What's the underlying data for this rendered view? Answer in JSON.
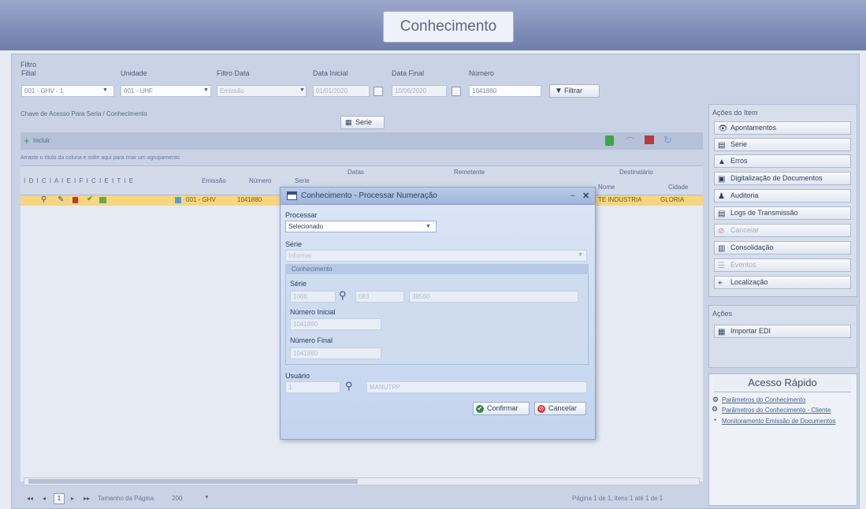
{
  "header": {
    "title": "Conhecimento"
  },
  "filters": {
    "legend": "Filtro",
    "filial": {
      "label": "Filial",
      "value": "001 - GHV - 1"
    },
    "unidade": {
      "label": "Unidade",
      "value": "001 - UHF"
    },
    "filtro_data": {
      "label": "Filtro Data",
      "value": "Emissão"
    },
    "data_inicial": {
      "label": "Data Inicial",
      "value": "01/01/2020"
    },
    "data_final": {
      "label": "Data Final",
      "value": "10/06/2020"
    },
    "numero": {
      "label": "Número",
      "value": "1041880"
    },
    "filter_button": "Filtrar"
  },
  "grid": {
    "info": "Chave de Acesso Para Seria / Conhecimento",
    "serie_button": "Serie",
    "add_button": "Incluir",
    "drag_hint": "Arraste o título da coluna e solte aqui para criar um agrupamento",
    "headers": {
      "letters": "I  D  I  C  I  A  I  E  I  F  I  C  I  E  I  T  I  E",
      "emissao": "Emissão",
      "numero": "Número",
      "serie": "Serie",
      "datas": "Datas",
      "remetente": "Remetente",
      "destinatario": "Destinatário",
      "nome": "Nome",
      "cidade": "Cidade"
    },
    "row": {
      "unidade": "001 - GHV",
      "numero": "1041880",
      "nome": "TE INDUSTRIA",
      "cidade": "GLORIA"
    },
    "pager": {
      "current_page": "1",
      "page_size_label": "Tamanho da Página",
      "page_size": "200",
      "status": "Página 1 de 1, itens 1 até 1 de 1"
    }
  },
  "side_actions": {
    "title": "Ações do Item",
    "items": [
      {
        "label": "Apontamentos",
        "icon": "eye-icon",
        "dim": false
      },
      {
        "label": "Serie",
        "icon": "doc-icon",
        "dim": false
      },
      {
        "label": "Erros",
        "icon": "warning-icon",
        "dim": false
      },
      {
        "label": "Digitalização de Documentos",
        "icon": "scanner-icon",
        "dim": false
      },
      {
        "label": "Auditoria",
        "icon": "user-icon",
        "dim": false
      },
      {
        "label": "Logs de Transmissão",
        "icon": "log-icon",
        "dim": false
      },
      {
        "label": "Cancelar",
        "icon": "cancel-icon",
        "dim": true
      },
      {
        "label": "Consolidação",
        "icon": "chart-icon",
        "dim": false
      },
      {
        "label": "Eventos",
        "icon": "list-icon",
        "dim": true
      },
      {
        "label": "Localização",
        "icon": "location-icon",
        "dim": false
      }
    ]
  },
  "side_acoes": {
    "title": "Ações",
    "items": [
      {
        "label": "Importar EDI",
        "icon": "import-icon"
      }
    ]
  },
  "quick_access": {
    "title": "Acesso Rápido",
    "links": [
      "Parâmetros do Conhecimento",
      "Parâmetros do Conhecimento - Cliente",
      "Monitoramento Emissão de Documentos"
    ]
  },
  "modal": {
    "title": "Conhecimento - Processar Numeração",
    "processar": {
      "label": "Processar",
      "value": "Selecionado"
    },
    "serie_top": {
      "label": "Série",
      "value": "Informar"
    },
    "fieldset_legend": "Conhecimento",
    "serie": {
      "label": "Série",
      "code": "1006",
      "val2": "083",
      "val3": "38560"
    },
    "numero_inicial": {
      "label": "Número Inicial",
      "value": "1041880"
    },
    "numero_final": {
      "label": "Número Final",
      "value": "1041880"
    },
    "usuario": {
      "label": "Usuário",
      "code": "1",
      "name": "MANUTPP"
    },
    "confirm_button": "Confirmar",
    "cancel_button": "Cancelar"
  }
}
